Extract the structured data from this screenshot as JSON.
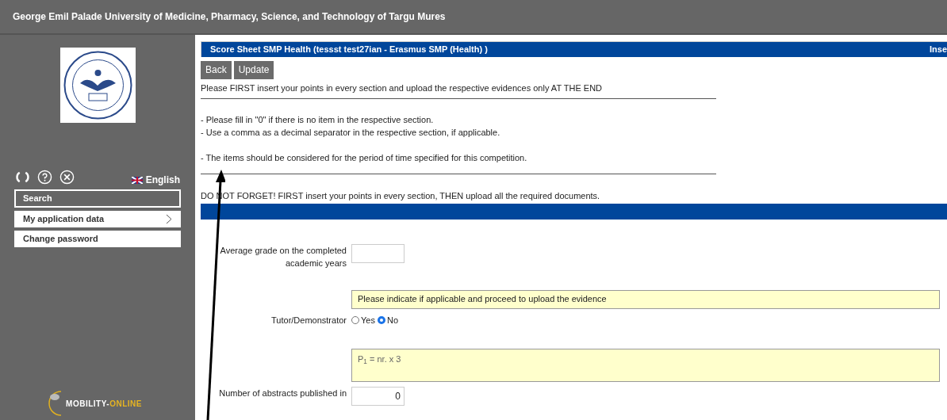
{
  "window": {
    "title": "George Emil Palade University of Medicine, Pharmacy, Science, and Technology of Targu Mures"
  },
  "sidebar": {
    "language": "English",
    "items": [
      {
        "label": "Search",
        "selected": true,
        "chevron": false
      },
      {
        "label": "My application data",
        "selected": false,
        "chevron": true
      },
      {
        "label": "Change password",
        "selected": false,
        "chevron": false
      }
    ],
    "footer_logo": {
      "part_1": "MOBILITY-",
      "part_2": "ONLINE"
    }
  },
  "header": {
    "title": "Score Sheet SMP Health (tessst test27ian - Erasmus SMP (Health) )",
    "right_text": "Inse"
  },
  "buttons": [
    "Back",
    "Update"
  ],
  "instructions": [
    {
      "kind": "text",
      "text": "Please FIRST insert your points in every section and upload the respective evidences only AT THE END"
    },
    {
      "kind": "rule"
    },
    {
      "kind": "text",
      "text": "- Please fill in \"0\" if there is no item in the respective section."
    },
    {
      "kind": "text",
      "text": "- Use a comma as a decimal separator in the respective section, if applicable."
    },
    {
      "kind": "spaced_text",
      "text": "- The items should be considered for the period of time specified for this competition."
    },
    {
      "kind": "rule"
    },
    {
      "kind": "text",
      "text": "DO NOT FORGET! FIRST insert your points in every section, THEN upload all the required documents."
    }
  ],
  "form": [
    {
      "kind": "input",
      "label": "Average grade on the completed academic years"
    },
    {
      "kind": "note",
      "text": "Please indicate if applicable and proceed to upload the evidence"
    },
    {
      "kind": "radio",
      "label": "Tutor/Demonstrator",
      "options": [
        {
          "label": "Yes",
          "selected": false
        },
        {
          "label": "No",
          "selected": true
        }
      ]
    },
    {
      "kind": "note",
      "text": "P$_{1}$ = nr. x 3"
    },
    {
      "kind": "input",
      "label": "Number of abstracts published in",
      "value": "0"
    }
  ]
}
